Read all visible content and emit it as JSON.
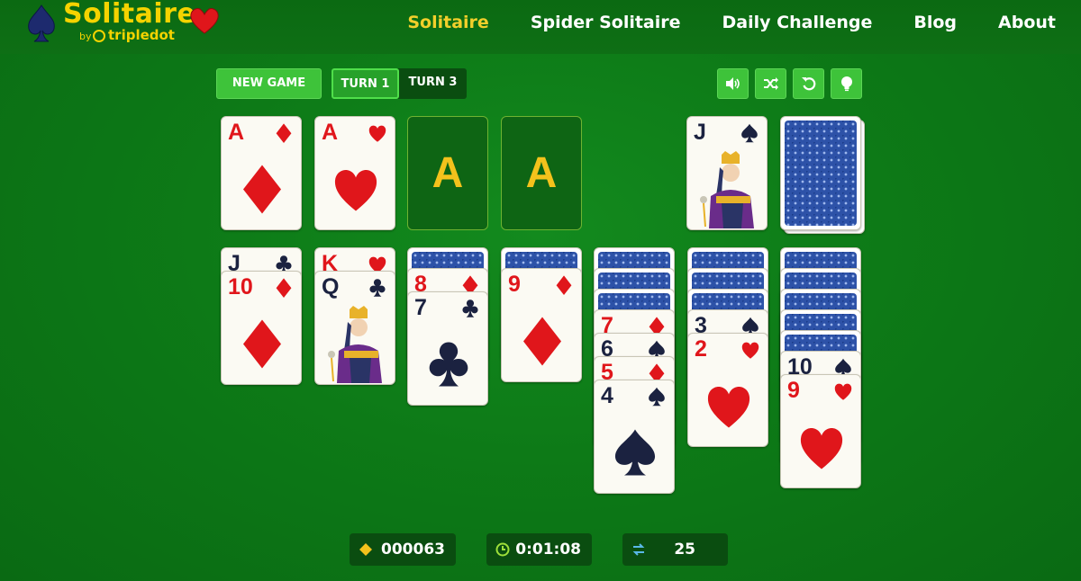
{
  "brand": {
    "title": "Solitaire",
    "by": "by",
    "brand_name": "tripledot"
  },
  "nav": [
    {
      "label": "Solitaire",
      "active": true
    },
    {
      "label": "Spider Solitaire",
      "active": false
    },
    {
      "label": "Daily Challenge",
      "active": false
    },
    {
      "label": "Blog",
      "active": false
    },
    {
      "label": "About",
      "active": false
    }
  ],
  "toolbar": {
    "new_game": "NEW GAME",
    "turn1": "TURN 1",
    "turn3": "TURN 3",
    "icons": [
      "sound-icon",
      "shuffle-icon",
      "undo-icon",
      "hint-icon"
    ]
  },
  "foundations": [
    {
      "rank": "A",
      "suit": "diamond",
      "color": "red"
    },
    {
      "rank": "A",
      "suit": "heart",
      "color": "red"
    },
    {
      "placeholder": "A"
    },
    {
      "placeholder": "A"
    }
  ],
  "waste": {
    "rank": "J",
    "suit": "spade",
    "color": "black"
  },
  "tableau": [
    {
      "hidden": 0,
      "cards": [
        {
          "rank": "J",
          "suit": "club",
          "color": "black"
        },
        {
          "rank": "10",
          "suit": "diamond",
          "color": "red"
        }
      ]
    },
    {
      "hidden": 0,
      "cards": [
        {
          "rank": "K",
          "suit": "heart",
          "color": "red"
        },
        {
          "rank": "Q",
          "suit": "club",
          "color": "black"
        }
      ]
    },
    {
      "hidden": 1,
      "cards": [
        {
          "rank": "8",
          "suit": "diamond",
          "color": "red"
        },
        {
          "rank": "7",
          "suit": "club",
          "color": "black"
        }
      ]
    },
    {
      "hidden": 1,
      "cards": [
        {
          "rank": "9",
          "suit": "diamond",
          "color": "red"
        }
      ]
    },
    {
      "hidden": 3,
      "cards": [
        {
          "rank": "7",
          "suit": "diamond",
          "color": "red"
        },
        {
          "rank": "6",
          "suit": "spade",
          "color": "black"
        },
        {
          "rank": "5",
          "suit": "diamond",
          "color": "red"
        },
        {
          "rank": "4",
          "suit": "spade",
          "color": "black"
        }
      ]
    },
    {
      "hidden": 3,
      "cards": [
        {
          "rank": "3",
          "suit": "spade",
          "color": "black"
        },
        {
          "rank": "2",
          "suit": "heart",
          "color": "red"
        }
      ]
    },
    {
      "hidden": 5,
      "cards": [
        {
          "rank": "10",
          "suit": "spade",
          "color": "black"
        },
        {
          "rank": "9",
          "suit": "heart",
          "color": "red"
        }
      ]
    }
  ],
  "stats": {
    "score": "000063",
    "time": "0:01:08",
    "moves": "25"
  },
  "colors": {
    "accent": "#f2cf2b",
    "button": "#3ec33a",
    "red_suit": "#e0161b",
    "black_suit": "#1b2240"
  }
}
